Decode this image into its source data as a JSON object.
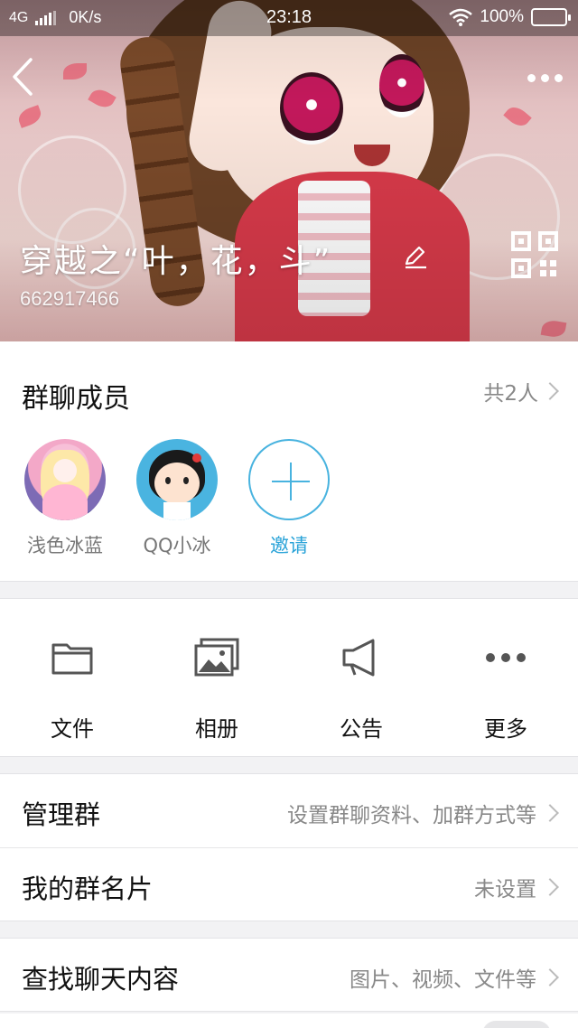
{
  "status_bar": {
    "network": "4G",
    "speed": "0K/s",
    "time": "23:18",
    "battery_percent": "100%",
    "battery_level": 1.0
  },
  "header": {
    "group_name": "穿越之“叶，花，斗”",
    "group_id": "662917466"
  },
  "members": {
    "title": "群聊成员",
    "count": "共2人",
    "list": [
      {
        "name": "浅色冰蓝"
      },
      {
        "name": "QQ小冰"
      }
    ],
    "invite_label": "邀请"
  },
  "tools": [
    {
      "label": "文件",
      "icon": "folder-icon"
    },
    {
      "label": "相册",
      "icon": "album-icon"
    },
    {
      "label": "公告",
      "icon": "megaphone-icon"
    },
    {
      "label": "更多",
      "icon": "more-icon"
    }
  ],
  "settings": {
    "manage": {
      "label": "管理群",
      "value": "设置群聊资料、加群方式等"
    },
    "my_card": {
      "label": "我的群名片",
      "value": "未设置"
    },
    "search_history": {
      "label": "查找聊天内容",
      "value": "图片、视频、文件等"
    }
  },
  "colors": {
    "accent": "#48b3df",
    "text_primary": "#111111",
    "text_secondary": "#888888"
  }
}
